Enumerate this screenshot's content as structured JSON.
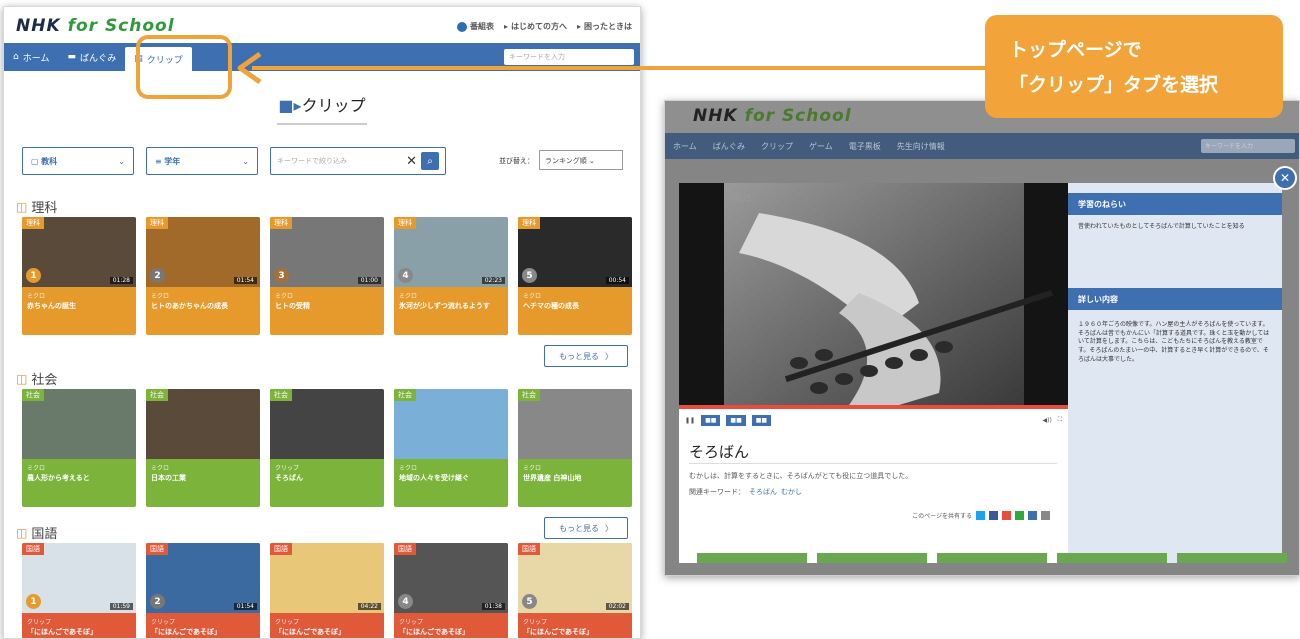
{
  "left": {
    "logo_nhk": "NHK",
    "logo_fs": "for School",
    "header_links": [
      "番組表",
      "はじめての方へ",
      "困ったときは"
    ],
    "nav": [
      "ホーム",
      "ばんぐみ",
      "クリップ"
    ],
    "search_placeholder": "キーワードを入力",
    "page_title": "クリップ",
    "filter_subject": "教科",
    "filter_grade": "学年",
    "keyword_placeholder": "キーワードで絞り込み",
    "sort_label": "並び替え：",
    "sort_value": "ランキング順",
    "more_label": "もっと見る",
    "sections": [
      {
        "title": "理科",
        "color": "#e69a2c",
        "cards": [
          {
            "cat": "理科",
            "type": "ミクロ",
            "title": "赤ちゃんの誕生",
            "dur": "01:28",
            "rank": "1",
            "rankc": "#e69a2c"
          },
          {
            "cat": "理科",
            "type": "ミクロ",
            "title": "ヒトのあかちゃんの成長",
            "dur": "01:54",
            "rank": "2",
            "rankc": "#777"
          },
          {
            "cat": "理科",
            "type": "ミクロ",
            "title": "ヒトの受精",
            "dur": "01:00",
            "rank": "3",
            "rankc": "#a5703a"
          },
          {
            "cat": "理科",
            "type": "ミクロ",
            "title": "氷河が少しずつ流れるようす",
            "dur": "02:23",
            "rank": "4",
            "rankc": "#888"
          },
          {
            "cat": "理科",
            "type": "ミクロ",
            "title": "ヘチマの種の成長",
            "dur": "00:54",
            "rank": "5",
            "rankc": "#888"
          }
        ]
      },
      {
        "title": "社会",
        "color": "#7cb33b",
        "cards": [
          {
            "cat": "社会",
            "type": "ミクロ",
            "title": "農人形から考えると",
            "dur": "",
            "rank": "",
            "rankc": ""
          },
          {
            "cat": "社会",
            "type": "ミクロ",
            "title": "日本の工業",
            "dur": "",
            "rank": "",
            "rankc": ""
          },
          {
            "cat": "社会",
            "type": "クリップ",
            "title": "そろばん",
            "dur": "",
            "rank": "",
            "rankc": ""
          },
          {
            "cat": "社会",
            "type": "ミクロ",
            "title": "地域の人々を受け継ぐ",
            "dur": "",
            "rank": "",
            "rankc": ""
          },
          {
            "cat": "社会",
            "type": "ミクロ",
            "title": "世界遺産 白神山地",
            "dur": "",
            "rank": "",
            "rankc": ""
          }
        ]
      },
      {
        "title": "国語",
        "color": "#e05a3a",
        "cards": [
          {
            "cat": "国語",
            "type": "クリップ",
            "title": "「にほんごであそぼ」",
            "dur": "01:59",
            "rank": "1",
            "rankc": "#e69a2c"
          },
          {
            "cat": "国語",
            "type": "クリップ",
            "title": "「にほんごであそぼ」",
            "dur": "01:54",
            "rank": "2",
            "rankc": "#777"
          },
          {
            "cat": "国語",
            "type": "クリップ",
            "title": "「にほんごであそぼ」",
            "dur": "04:22",
            "rank": "",
            "rankc": ""
          },
          {
            "cat": "国語",
            "type": "クリップ",
            "title": "「にほんごであそぼ」",
            "dur": "01:38",
            "rank": "4",
            "rankc": "#888"
          },
          {
            "cat": "国語",
            "type": "クリップ",
            "title": "「にほんごであそぼ」",
            "dur": "02:02",
            "rank": "5",
            "rankc": "#888"
          }
        ]
      }
    ]
  },
  "callout": {
    "line1": "トップページで",
    "line2": "「クリップ」タブを選択"
  },
  "right": {
    "logo_nhk": "NHK",
    "logo_fs": "for School",
    "nav": [
      "ホーム",
      "ばんぐみ",
      "クリップ",
      "ゲーム",
      "電子黒板",
      "先生向け情報"
    ],
    "search_placeholder": "キーワードを入力",
    "video_title": "そろばん",
    "video_desc": "むかしは、計算をするときに、そろばんがとても役に立つ道具でした。",
    "kw_label": "関連キーワード：",
    "kw_links": [
      "そろばん",
      "むかし"
    ],
    "share_label": "このページを共有する",
    "panel_head1": "学習のねらい",
    "panel_body1": "昔使われていたものとしてそろばんで計算していたことを知る",
    "panel_head2": "詳しい内容",
    "panel_body2": "１９６０年ごろの映像です。ハン屋の主人がそろばんを使っています。そろばんは昔でもかんにい「計算する道具です。珠くと玉を動かしてはいて計算をします。こちらは、こどもたちにそろばんを教える教室です。そろばんのたまい一の中、計算するとき早く計算ができるので、そろばんは大事でした。"
  }
}
